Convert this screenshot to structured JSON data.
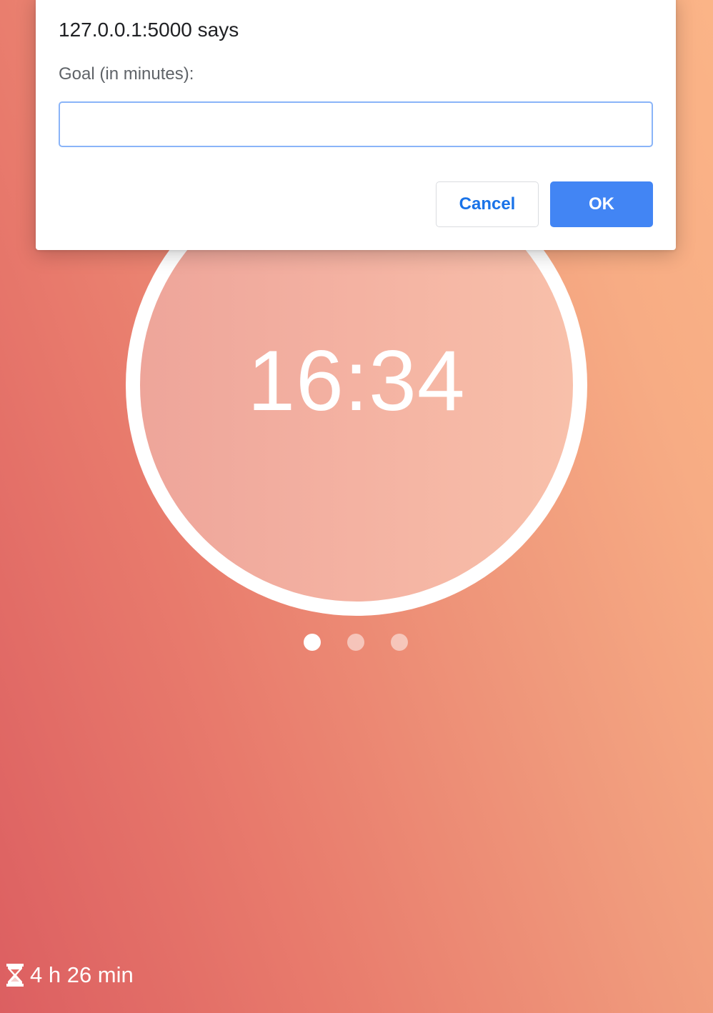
{
  "dialog": {
    "title": "127.0.0.1:5000 says",
    "message": "Goal (in minutes):",
    "input_value": "",
    "cancel_label": "Cancel",
    "ok_label": "OK"
  },
  "timer": {
    "time": "16:34"
  },
  "pager": {
    "count": 3,
    "active_index": 0
  },
  "footer": {
    "icon": "hourglass-icon",
    "total_time": "4 h 26 min"
  },
  "colors": {
    "accent_button": "#4285f4",
    "cancel_text": "#1a73e8",
    "background_start": "#dc5f61",
    "background_end": "#fbb487"
  }
}
